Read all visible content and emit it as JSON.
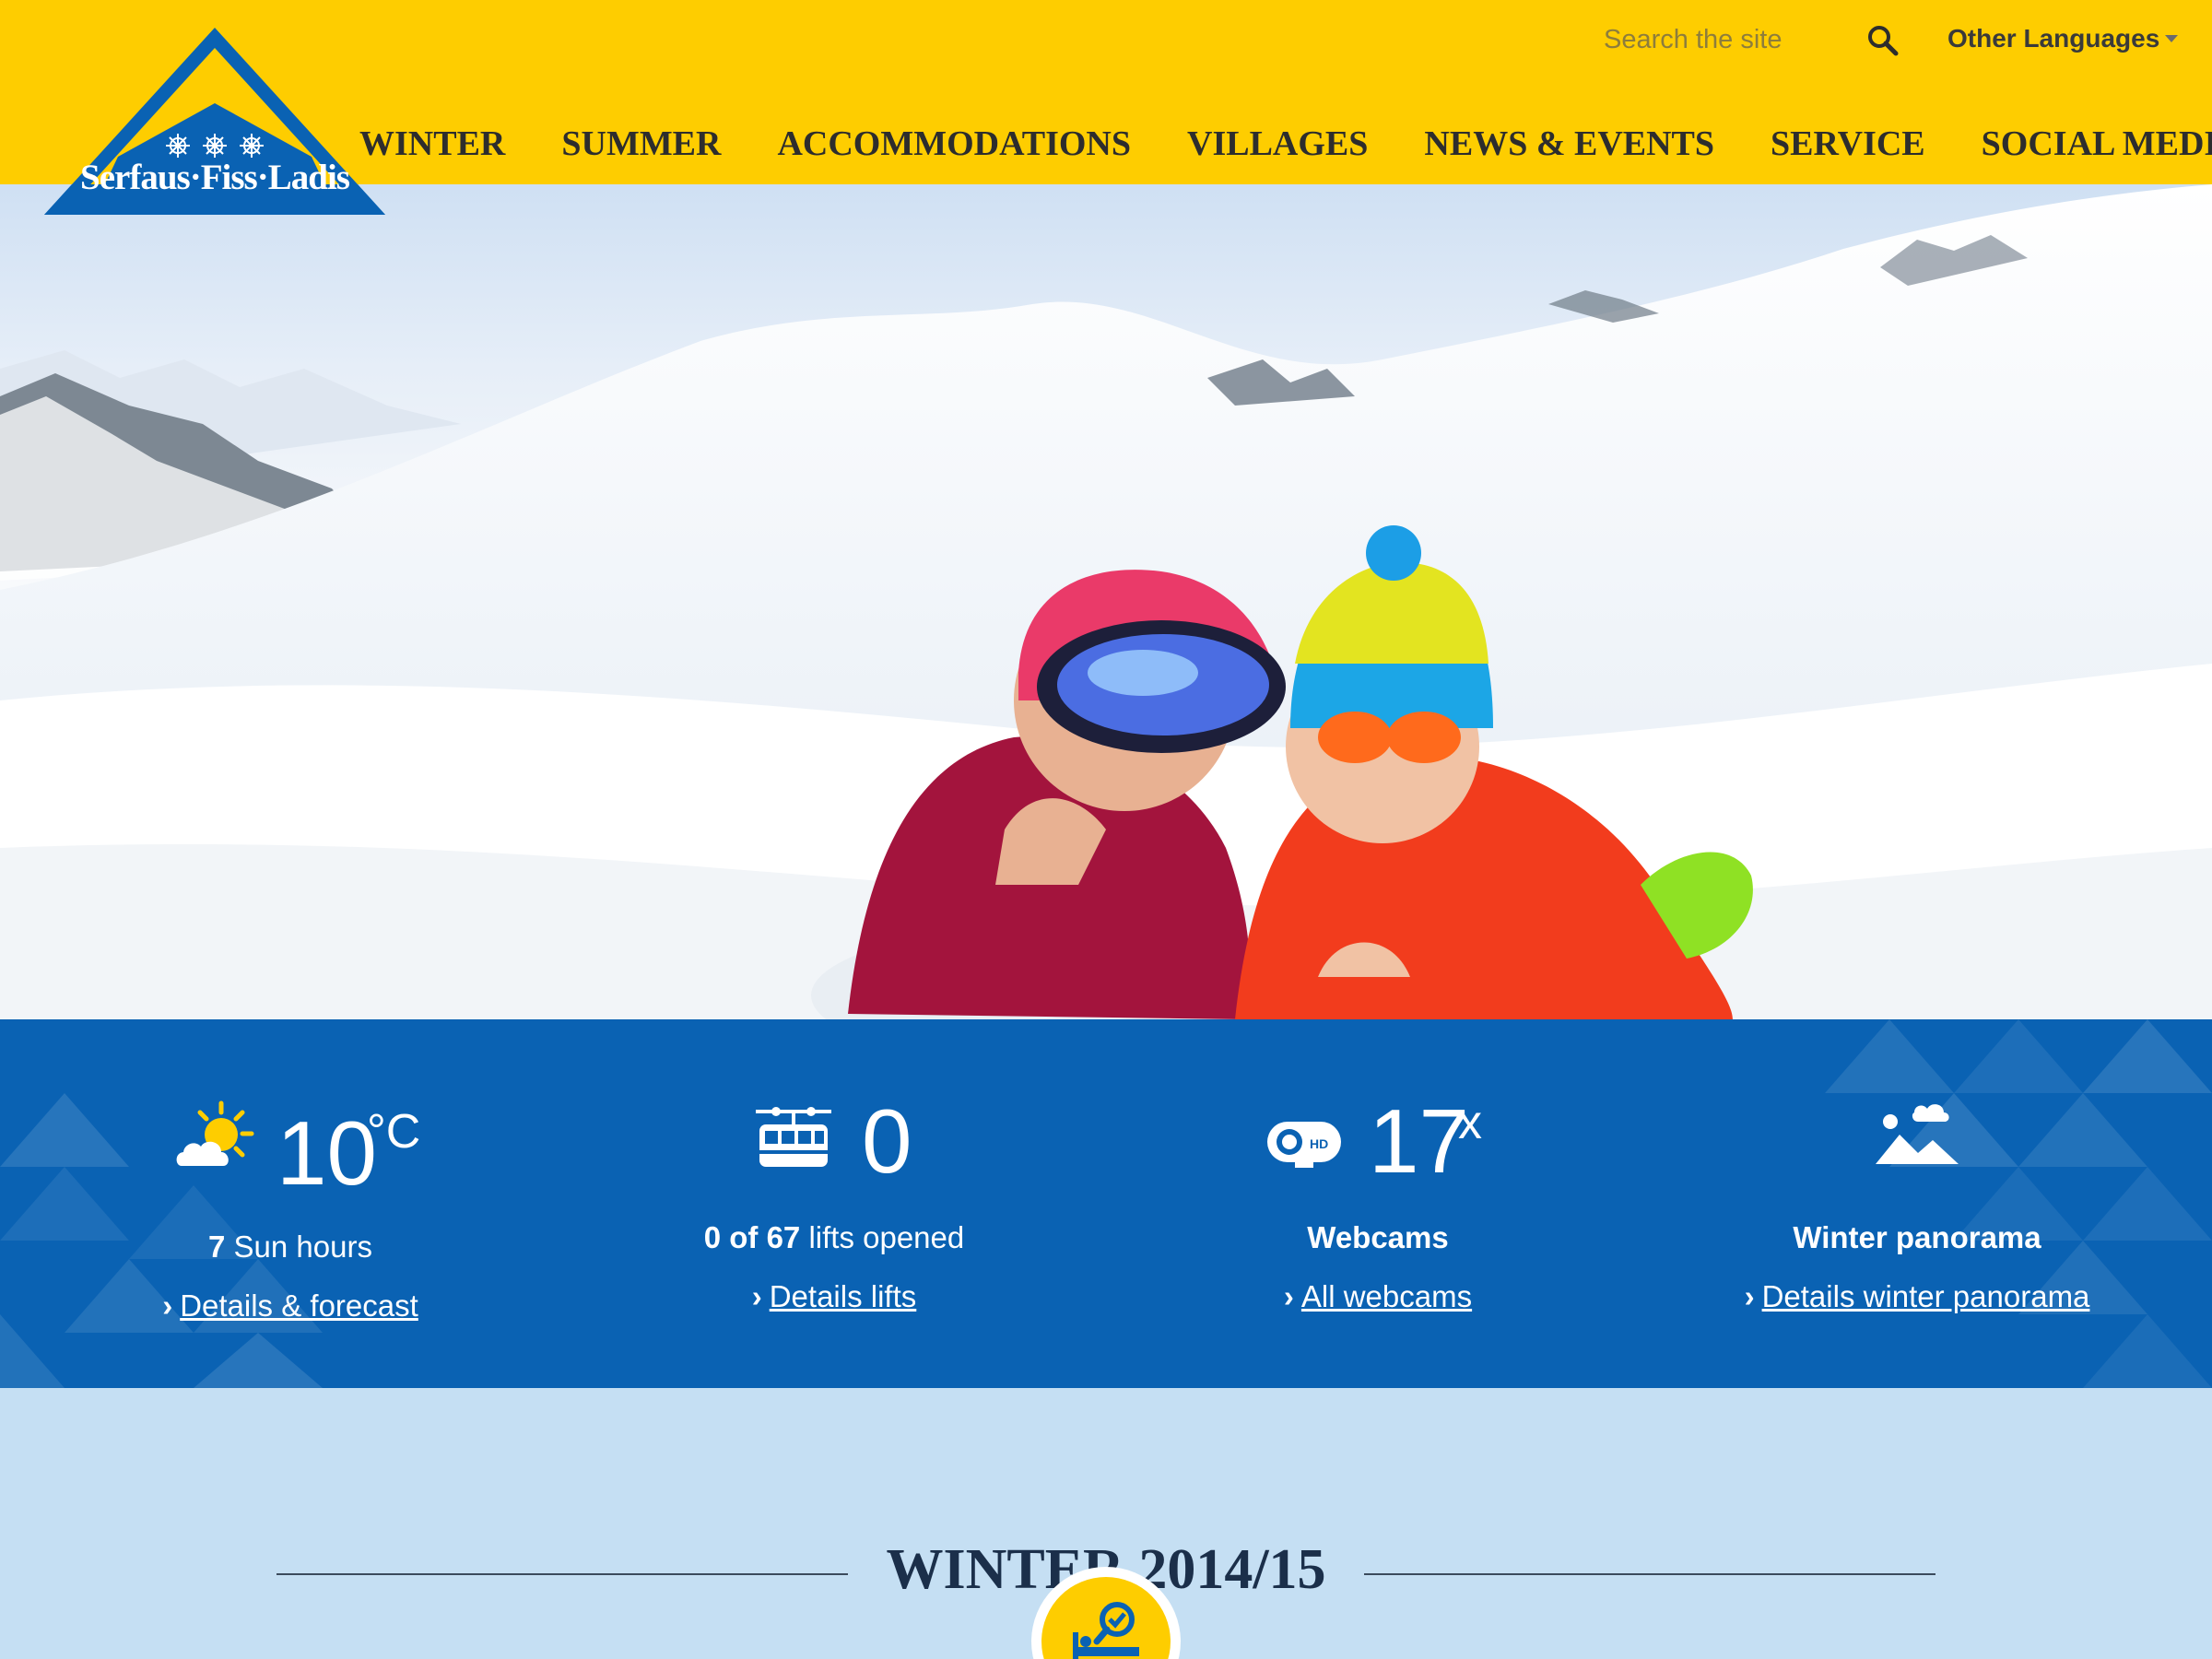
{
  "brand": {
    "logo_text": "Serfaus·Fiss·Ladis",
    "colors": {
      "header": "#fecd00",
      "logo_blue": "#0a62b3",
      "band": "#0a62b3",
      "section_bg": "#c5dff3"
    }
  },
  "header": {
    "search": {
      "placeholder": "Search the site",
      "icon": "search-icon"
    },
    "language": {
      "label": "Other Languages"
    },
    "nav": [
      "WINTER",
      "SUMMER",
      "ACCOMMODATIONS",
      "VILLAGES",
      "NEWS & EVENTS",
      "SERVICE",
      "SOCIAL MEDIA"
    ]
  },
  "hero": {
    "image": "two-girls-in-snow-photo"
  },
  "info": {
    "weather": {
      "icon": "weather-sun-cloud-icon",
      "value": "10",
      "unit": "°C",
      "sun_hours_value": "7",
      "sun_hours_text": "Sun hours",
      "link": "Details & forecast"
    },
    "lifts": {
      "icon": "gondola-icon",
      "value": "0",
      "label_bold": "0 of 67",
      "label_text": "lifts opened",
      "link": "Details lifts"
    },
    "webcams": {
      "icon": "webcam-icon",
      "value": "17",
      "unit": "x",
      "label": "Webcams",
      "link": "All webcams"
    },
    "panorama": {
      "icon": "panorama-icon",
      "label": "Winter panorama",
      "link": "Details winter panorama"
    }
  },
  "section": {
    "title": "WINTER  2014/15",
    "badge_icon": "accommodation-search-icon"
  }
}
